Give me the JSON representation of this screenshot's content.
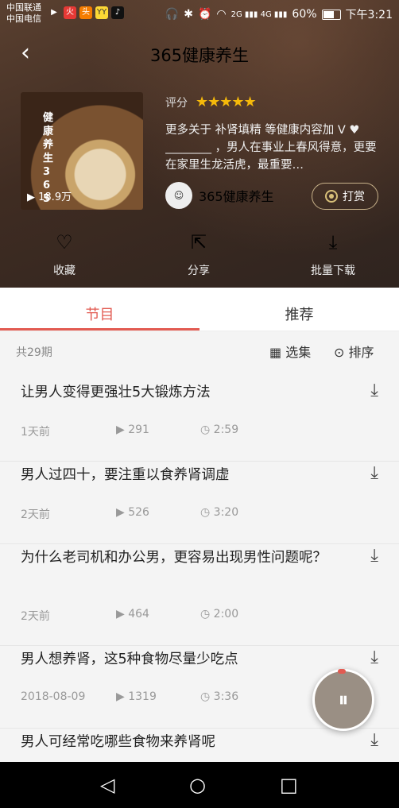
{
  "status": {
    "carrier1": "中国联通",
    "carrier2": "中国电信",
    "apps": [
      "▶",
      "火",
      "头",
      "YY",
      "♪"
    ],
    "signal_labels": "2G ▮▮▮ 4G ▮▮▮",
    "battery": "60%",
    "time": "下午3:21",
    "battery_level": 0.6
  },
  "header": {
    "back_icon": "back-arrow-icon",
    "title": "365健康养生"
  },
  "album": {
    "cover_title": "健康养生365",
    "plays": "18.9万",
    "rating_label": "评分",
    "rating_value": 4.5,
    "stars": "★★★★★",
    "description": "更多关于 补肾填精 等健康内容加 V ♥ ________ ，男人在事业上春风得意，更要在家里生龙活虎，最重要…",
    "author_name": "365健康养生",
    "reward_label": "打赏"
  },
  "actions": [
    {
      "icon": "heart-icon",
      "glyph": "♡",
      "label": "收藏"
    },
    {
      "icon": "share-icon",
      "glyph": "⇱",
      "label": "分享"
    },
    {
      "icon": "download-icon",
      "glyph": "⤓",
      "label": "批量下载"
    }
  ],
  "tabs": [
    {
      "label": "节目",
      "active": true
    },
    {
      "label": "推荐",
      "active": false
    }
  ],
  "list_header": {
    "count": "共29期",
    "select": "选集",
    "sort": "排序"
  },
  "episodes": [
    {
      "title": "让男人变得更强壮5大锻炼方法",
      "date": "1天前",
      "plays": "291",
      "duration": "2:59"
    },
    {
      "title": "男人过四十，要注重以食养肾调虚",
      "date": "2天前",
      "plays": "526",
      "duration": "3:20"
    },
    {
      "title": "为什么老司机和办公男，更容易出现男性问题呢？",
      "date": "2天前",
      "plays": "464",
      "duration": "2:00"
    },
    {
      "title": "男人想养肾，这5种食物尽量少吃点",
      "date": "2018-08-09",
      "plays": "1319",
      "duration": "3:36"
    },
    {
      "title": "男人可经常吃哪些食物来养肾呢",
      "date": "",
      "plays": "",
      "duration": ""
    }
  ],
  "player": {
    "icon": "now-playing-icon",
    "glyph": "⏸"
  },
  "navbar": {
    "back": "◁",
    "home": "○",
    "recent": "□"
  }
}
